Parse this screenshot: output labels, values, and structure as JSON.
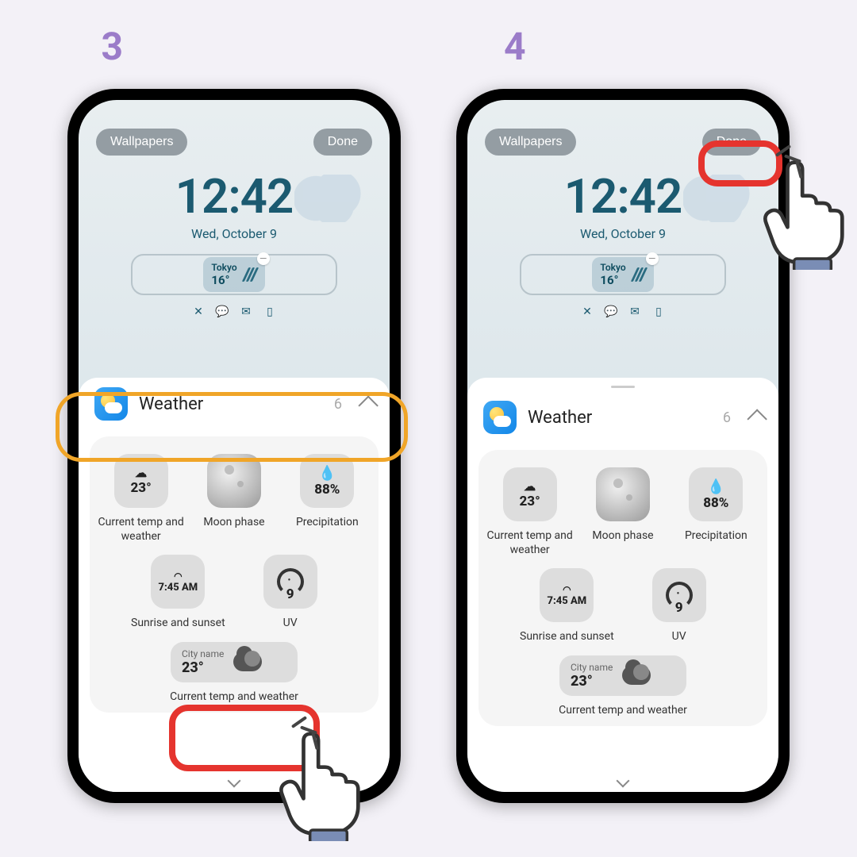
{
  "steps": {
    "left": "3",
    "right": "4"
  },
  "topbar": {
    "wallpapers": "Wallpapers",
    "done": "Done"
  },
  "clock": {
    "time": "12:42",
    "date": "Wed, October 9"
  },
  "miniWidget": {
    "city": "Tokyo",
    "temp": "16°"
  },
  "panel": {
    "title": "Weather",
    "count": "6"
  },
  "widgets": {
    "currentTemp": {
      "value": "23°",
      "label": "Current temp and weather"
    },
    "moon": {
      "label": "Moon phase"
    },
    "precip": {
      "value": "88%",
      "label": "Precipitation"
    },
    "sunrise": {
      "value": "7:45 AM",
      "label": "Sunrise and sunset"
    },
    "uv": {
      "value": "9",
      "label": "UV"
    },
    "wide": {
      "city": "City name",
      "temp": "23°",
      "label": "Current temp and weather"
    }
  }
}
